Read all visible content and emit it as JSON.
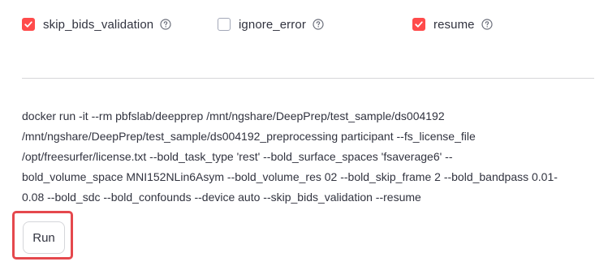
{
  "options": [
    {
      "label": "skip_bids_validation",
      "checked": true,
      "help_icon": "question-circle-icon"
    },
    {
      "label": "ignore_error",
      "checked": false,
      "help_icon": "question-circle-icon"
    },
    {
      "label": "resume",
      "checked": true,
      "help_icon": "question-circle-icon"
    }
  ],
  "command": {
    "lines": [
      "docker run -it --rm pbfslab/deepprep /mnt/ngshare/DeepPrep/test_sample/ds004192",
      "/mnt/ngshare/DeepPrep/test_sample/ds004192_preprocessing participant --fs_license_file",
      "/opt/freesurfer/license.txt --bold_task_type 'rest' --bold_surface_spaces 'fsaverage6' --",
      "bold_volume_space MNI152NLin6Asym --bold_volume_res 02 --bold_skip_frame 2 --bold_bandpass 0.01-",
      "0.08 --bold_sdc --bold_confounds --device auto --skip_bids_validation --resume"
    ]
  },
  "run_button": {
    "label": "Run"
  },
  "colors": {
    "accent": "#ff4b4b",
    "highlight_border": "#e5484d",
    "text": "#31333f",
    "divider": "#d6d6d9"
  }
}
